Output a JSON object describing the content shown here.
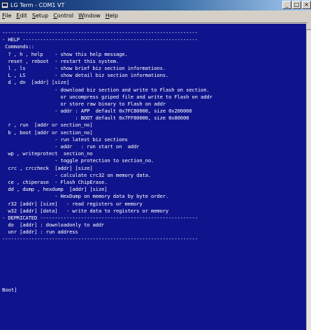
{
  "window": {
    "title": "LG Term - COM1 VT"
  },
  "title_buttons": {
    "minimize": "_",
    "maximize": "□",
    "close": "×"
  },
  "menu": [
    "File",
    "Edit",
    "Setup",
    "Control",
    "Window",
    "Help"
  ],
  "terminal": {
    "lines": [
      "-------------------------------------------------------------------",
      "- HELP ------------------------------------------------------------",
      " Commands::",
      "  ? , h , help    - show this help message.",
      "  reset , reboot  - restart this system.",
      "  l , ls          - show brief biz section informations.",
      "  L , LS          - show detail biz section informations.",
      "  d , dn  [addr] [size]",
      "                  - download biz section and write to Flash on section.",
      "                    or uncompress gziped file and write to Flash on addr",
      "                    or store raw binary to Flash on addr",
      "                  - addr : APP  default 0x7FC80000, size 0x200000",
      "                         : BOOT default 0x7FF80000, size 0x80000",
      "  r , run  [addr or section_no]",
      "  b , boot [addr or section_no]",
      "                  - run latest biz sections",
      "                  - addr   : run start on  addr",
      "  wp , writeprotect  section_no",
      "                  - toggle protection to section_no.",
      "  crc , crccheck  [addr] [size]",
      "                  - calculate crc32 on memory data.",
      "  ce , chiperase  - Flash ChipErase.",
      "  dd , dump , hexdump  [addr] [size]",
      "                  - HexDump on memory data by byte order.",
      "  r32 [addr] [size]   - read registers or memory",
      "  w32 [addr] [data]   - write data to registers or memory",
      "- DEPRICATED ------------------------------------------------------",
      "  do  [addr] : downloadonly to addr",
      "  unr [addr] : run address",
      "-------------------------------------------------------------------"
    ],
    "prompt": "Boot]"
  }
}
